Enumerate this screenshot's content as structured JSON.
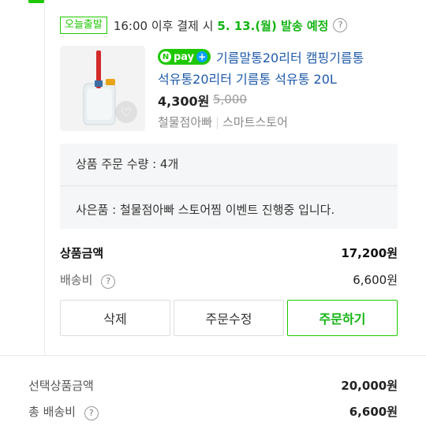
{
  "shipping": {
    "badge": "오늘출발",
    "text": "16:00 이후 결제 시",
    "date": "5. 13.(월) 발송 예정",
    "help": "?"
  },
  "product": {
    "pay_label": "pay",
    "pay_n": "N",
    "title_line1": "기름말통20리터 캠핑기름통",
    "title_line2": "석유통20리터 기름통 석유통 20L",
    "price": "4,300원",
    "original_price": "5,000",
    "seller": "철물점아빠",
    "store": "스마트스토어"
  },
  "options": {
    "quantity": "상품 주문 수량 : 4개",
    "gift": "사은품 : 철물점아빠 스토어찜 이벤트 진행중 입니다."
  },
  "summary": {
    "product_amount_label": "상품금액",
    "product_amount": "17,200원",
    "shipping_label": "배송비",
    "shipping_fee": "6,600원"
  },
  "buttons": {
    "delete": "삭제",
    "edit": "주문수정",
    "order": "주문하기"
  },
  "footer": {
    "selected_amount_label": "선택상품금액",
    "selected_amount": "20,000원",
    "total_shipping_label": "총 배송비",
    "total_shipping": "6,600원"
  },
  "colors": {
    "accent_green": "#1ec800",
    "link_blue": "#1f5aa8"
  }
}
